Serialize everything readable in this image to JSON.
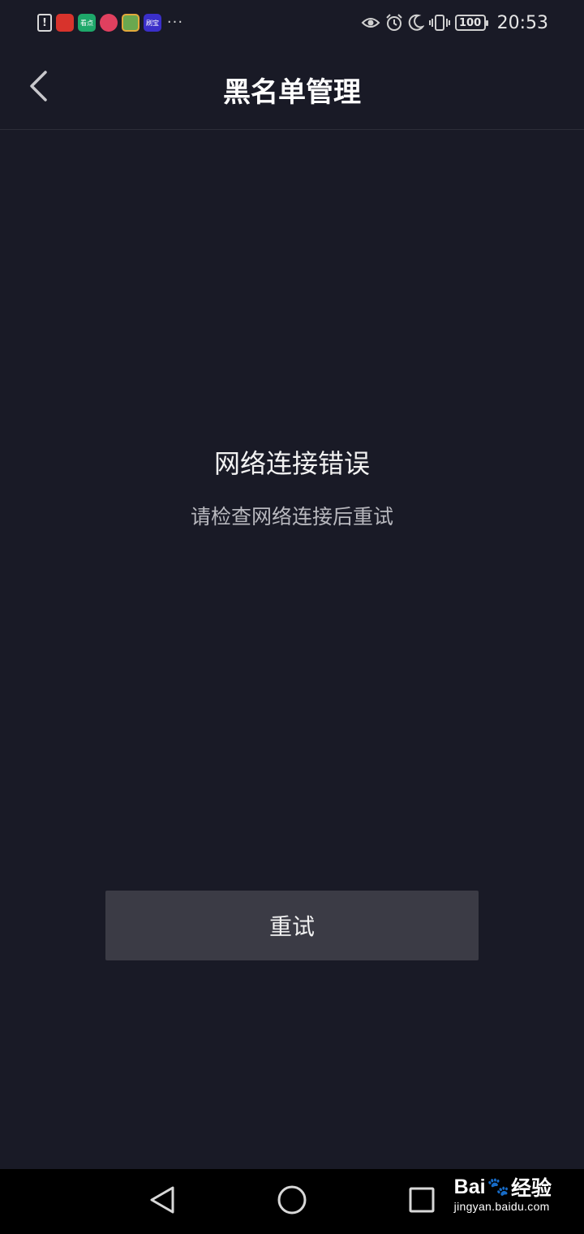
{
  "status_bar": {
    "notification_icons": [
      "alert-icon",
      "app-icon-red",
      "app-icon-kandian",
      "app-icon-pink",
      "app-icon-book",
      "app-icon-shuabao"
    ],
    "notification_labels": {
      "red": "",
      "kandian": "看点",
      "shuabao": "刷宝"
    },
    "more": "···",
    "system_icons": [
      "eye-icon",
      "alarm-icon",
      "moon-icon",
      "vibrate-icon"
    ],
    "battery": "100",
    "time": "20:53"
  },
  "header": {
    "title": "黑名单管理",
    "back_icon": "chevron-left-icon"
  },
  "content": {
    "error_title": "网络连接错误",
    "error_message": "请检查网络连接后重试",
    "retry_label": "重试"
  },
  "nav_bar": {
    "icons": [
      "back-triangle-icon",
      "home-circle-icon",
      "recents-square-icon"
    ]
  },
  "watermark": {
    "brand": "Bai",
    "brand_suffix": "经验",
    "url": "jingyan.baidu.com"
  },
  "colors": {
    "background": "#191a26",
    "button": "#3b3b45",
    "nav": "#000000"
  }
}
